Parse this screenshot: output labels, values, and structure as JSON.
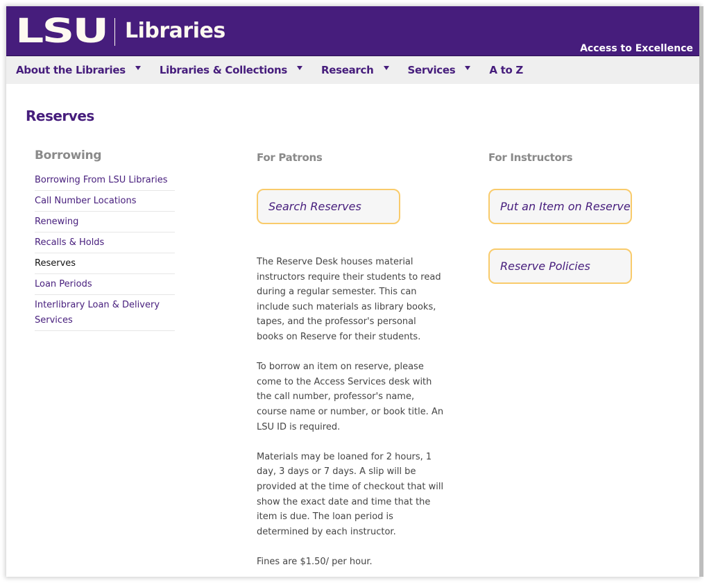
{
  "header": {
    "logo_lsu": "LSU",
    "logo_libraries": "Libraries",
    "tagline": "Access to Excellence",
    "brand_color": "#461d7c",
    "accent_color": "#f9cb6b"
  },
  "nav": {
    "items": [
      {
        "label": "About the Libraries",
        "has_dropdown": true
      },
      {
        "label": "Libraries & Collections",
        "has_dropdown": true
      },
      {
        "label": "Research",
        "has_dropdown": true
      },
      {
        "label": "Services",
        "has_dropdown": true
      },
      {
        "label": "A to Z",
        "has_dropdown": false
      }
    ]
  },
  "page": {
    "title": "Reserves"
  },
  "sidebar": {
    "heading": "Borrowing",
    "items": [
      {
        "label": "Borrowing From LSU Libraries",
        "active": false
      },
      {
        "label": "Call Number Locations",
        "active": false
      },
      {
        "label": "Renewing",
        "active": false
      },
      {
        "label": "Recalls & Holds",
        "active": false
      },
      {
        "label": "Reserves",
        "active": true
      },
      {
        "label": "Loan Periods",
        "active": false
      },
      {
        "label": "Interlibrary Loan & Delivery Services",
        "active": false
      }
    ]
  },
  "patrons": {
    "heading": "For Patrons",
    "button": "Search Reserves",
    "paragraphs": [
      "The Reserve Desk houses material instructors require their students to read during a regular semester. This can include such materials as library books, tapes, and the professor's personal books on Reserve for their students.",
      "To borrow an item on reserve, please come to the Access Services desk with the call number, professor's name, course name or number, or book title. An LSU ID is required.",
      "Materials may be loaned for 2 hours, 1 day, 3 days or 7 days. A slip will be provided at the time of checkout that will show the exact date and time that the item is due. The loan period is determined by each instructor.",
      "Fines are $1.50/ per hour."
    ]
  },
  "instructors": {
    "heading": "For Instructors",
    "buttons": [
      "Put an Item on Reserve",
      "Reserve Policies"
    ]
  }
}
